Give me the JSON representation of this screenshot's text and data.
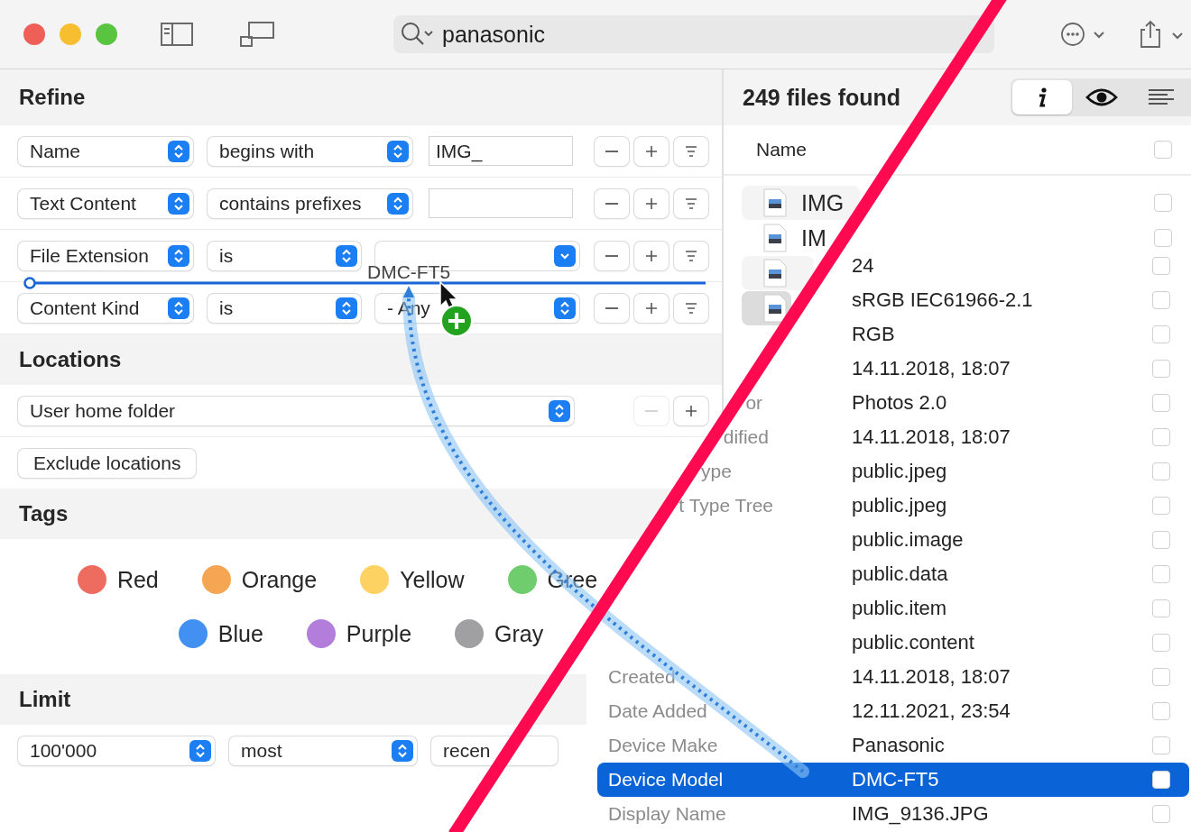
{
  "search": {
    "value": "panasonic"
  },
  "refine": {
    "title": "Refine",
    "criteria": [
      {
        "field": "Name",
        "operator": "begins with",
        "kind": "text",
        "value": "IMG_",
        "remove_disabled": false
      },
      {
        "field": "Text Content",
        "operator": "contains prefixes",
        "kind": "text",
        "remove_disabled": false
      },
      {
        "field": "File Extension",
        "operator": "is",
        "kind": "combo",
        "remove_disabled": false
      },
      {
        "field": "Content Kind",
        "operator": "is",
        "kind": "popup",
        "value": "- Any",
        "remove_disabled": false
      }
    ]
  },
  "locations": {
    "title": "Locations",
    "items": [
      {
        "value": "User home folder",
        "remove_disabled": true
      }
    ],
    "exclude_button": "Exclude locations"
  },
  "tags": {
    "title": "Tags",
    "rows": [
      [
        {
          "name": "Red",
          "color": "#ee6b60"
        },
        {
          "name": "Orange",
          "color": "#f5a652"
        },
        {
          "name": "Yellow",
          "color": "#fdd263"
        },
        {
          "name": "Gree",
          "color": "#70cd6e"
        }
      ],
      [
        {
          "name": "Blue",
          "color": "#4190f2"
        },
        {
          "name": "Purple",
          "color": "#b27ddb"
        },
        {
          "name": "Gray",
          "color": "#a0a0a2"
        }
      ]
    ]
  },
  "limit": {
    "title": "Limit",
    "count": "100'000",
    "order": "most",
    "sort": "recen"
  },
  "results": {
    "count_label": "249 files found",
    "view_modes": [
      {
        "kind": "info",
        "selected": true
      },
      {
        "kind": "preview",
        "selected": false
      },
      {
        "kind": "list",
        "selected": false
      }
    ],
    "column": "Name",
    "column_checked": false,
    "files": [
      {
        "name": "IMG",
        "selected": false,
        "checked": false
      },
      {
        "name": "IM",
        "selected": false,
        "checked": false
      },
      {
        "selected": false
      },
      {
        "selected": true
      }
    ]
  },
  "attributes": [
    {
      "value": "24",
      "checked": false,
      "selected": false
    },
    {
      "value": "sRGB IEC61966-2.1",
      "checked": false,
      "selected": false
    },
    {
      "value": "RGB",
      "checked": false,
      "selected": false
    },
    {
      "value": "14.11.2018, 18:07",
      "checked": false,
      "selected": false
    },
    {
      "label": "or",
      "value": "Photos 2.0",
      "checked": false,
      "selected": false
    },
    {
      "label": "dified",
      "value": "14.11.2018, 18:07",
      "checked": false,
      "selected": false
    },
    {
      "label": "ype",
      "value": "public.jpeg",
      "checked": false,
      "selected": false
    },
    {
      "label": "t Type Tree",
      "value": "public.jpeg",
      "checked": false,
      "selected": false
    },
    {
      "value": "public.image",
      "checked": false,
      "selected": false
    },
    {
      "value": "public.data",
      "checked": false,
      "selected": false
    },
    {
      "value": "public.item",
      "checked": false,
      "selected": false
    },
    {
      "value": "public.content",
      "checked": false,
      "selected": false
    },
    {
      "label": "Created",
      "value": "14.11.2018, 18:07",
      "checked": false,
      "selected": false
    },
    {
      "label": "Date Added",
      "value": "12.11.2021, 23:54",
      "checked": false,
      "selected": false
    },
    {
      "label": "Device Make",
      "value": "Panasonic",
      "checked": false,
      "selected": false
    },
    {
      "label": "Device Model",
      "value": "DMC-FT5",
      "checked": false,
      "selected": true
    },
    {
      "label": "Display Name",
      "value": "IMG_9136.JPG",
      "checked": false,
      "selected": false
    }
  ],
  "drag": {
    "label": "DMC-FT5"
  }
}
